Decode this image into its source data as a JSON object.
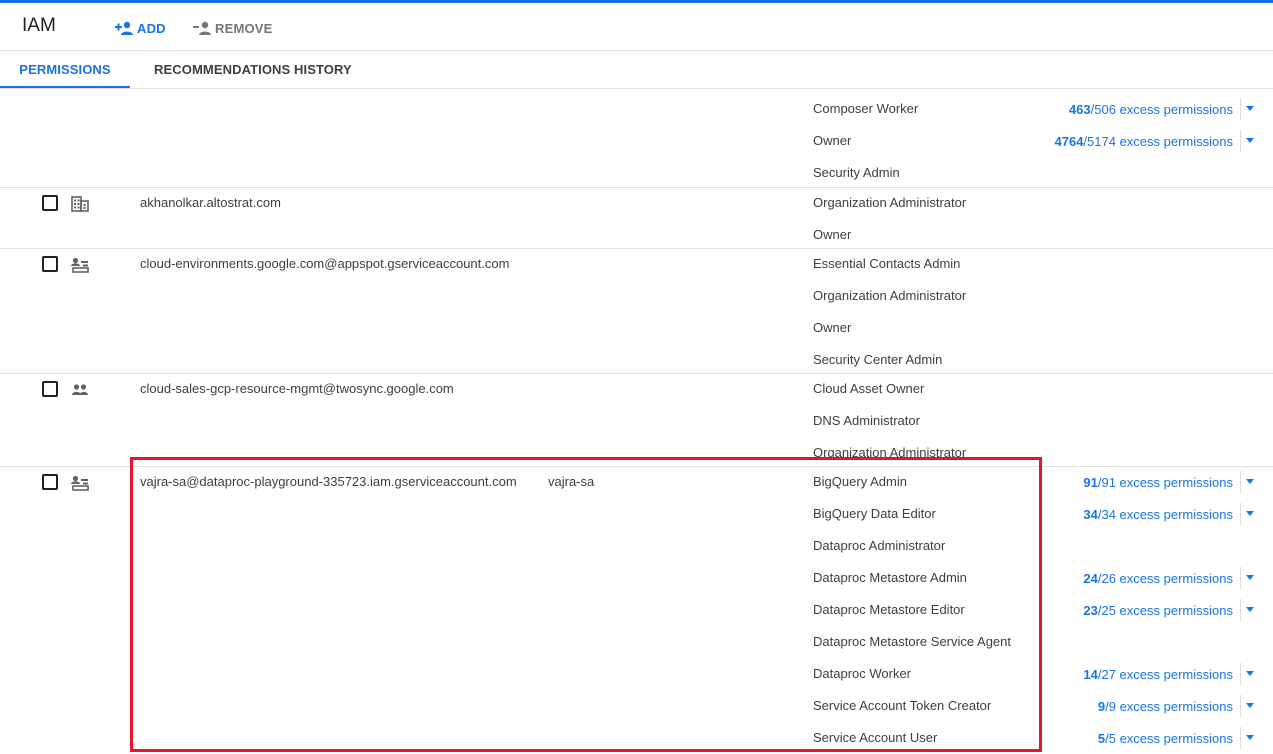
{
  "header": {
    "title": "IAM",
    "add_label": "ADD",
    "remove_label": "REMOVE"
  },
  "tabs": {
    "permissions": "PERMISSIONS",
    "recommendations": "RECOMMENDATIONS HISTORY"
  },
  "colors": {
    "accent": "#1a73e8",
    "highlight": "#e8132d"
  },
  "rows": {
    "r0": {
      "roles": [
        "Composer Worker",
        "Owner",
        "Security Admin"
      ],
      "excess": [
        {
          "count": "463",
          "total": "/506 excess permissions"
        },
        {
          "count": "4764",
          "total": "/5174 excess permissions"
        }
      ]
    },
    "r1": {
      "principal": "akhanolkar.altostrat.com",
      "type_icon": "domain-icon",
      "roles": [
        "Organization Administrator",
        "Owner"
      ]
    },
    "r2": {
      "principal": "cloud-environments.google.com@appspot.gserviceaccount.com",
      "type_icon": "service-account-icon",
      "roles": [
        "Essential Contacts Admin",
        "Organization Administrator",
        "Owner",
        "Security Center Admin"
      ]
    },
    "r3": {
      "principal": "cloud-sales-gcp-resource-mgmt@twosync.google.com",
      "type_icon": "group-icon",
      "roles": [
        "Cloud Asset Owner",
        "DNS Administrator",
        "Organization Administrator"
      ]
    },
    "r4": {
      "principal": "vajra-sa@dataproc-playground-335723.iam.gserviceaccount.com",
      "name": "vajra-sa",
      "type_icon": "service-account-icon",
      "roles": [
        "BigQuery Admin",
        "BigQuery Data Editor",
        "Dataproc Administrator",
        "Dataproc Metastore Admin",
        "Dataproc Metastore Editor",
        "Dataproc Metastore Service Agent",
        "Dataproc Worker",
        "Service Account Token Creator",
        "Service Account User"
      ],
      "excess": [
        {
          "count": "91",
          "total": "/91 excess permissions"
        },
        {
          "count": "34",
          "total": "/34 excess permissions"
        },
        {
          "count": "24",
          "total": "/26 excess permissions"
        },
        {
          "count": "23",
          "total": "/25 excess permissions"
        },
        {
          "count": "14",
          "total": "/27 excess permissions"
        },
        {
          "count": "9",
          "total": "/9 excess permissions"
        },
        {
          "count": "5",
          "total": "/5 excess permissions"
        }
      ]
    }
  }
}
